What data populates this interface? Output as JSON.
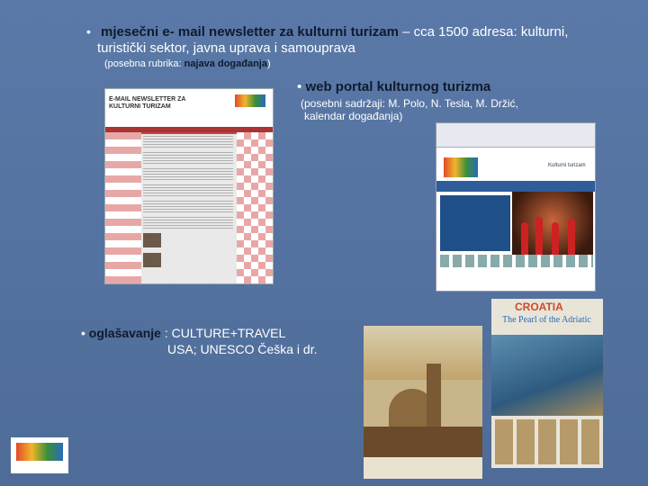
{
  "slide": {
    "bullet_glyph": "•",
    "item1": {
      "bold": "mjesečni e- mail newsletter za kulturni turizam",
      "rest": " – cca 1500 adresa: kulturni,",
      "line2": "turistički sektor, javna uprava i samouprava",
      "note_pre": "(posebna rubrika: ",
      "note_bold": "najava događanja",
      "note_post": ")"
    },
    "item2": {
      "bold": "web portal kulturnog turizma",
      "note_line1": "(posebni sadržaji: M. Polo, N. Tesla, M. Držić,",
      "note_line2": "kalendar događanja)"
    },
    "item3": {
      "bold": "oglašavanje",
      "rest": " : CULTURE+TRAVEL",
      "line2": "USA; UNESCO Češka i dr."
    }
  },
  "newsletter_image": {
    "header_text_1": "E-MAIL NEWSLETTER ZA",
    "header_text_2": "KULTURNI TURIZAM"
  },
  "portal_image": {
    "page_label": "Kulturni turizam"
  },
  "brochure_small": {
    "title": "CROATIA",
    "subtitle": "The Pearl of the Adriatic"
  },
  "colors": {
    "background": "#5677a4",
    "bold_text": "#101a2e",
    "text": "#ffffff"
  }
}
